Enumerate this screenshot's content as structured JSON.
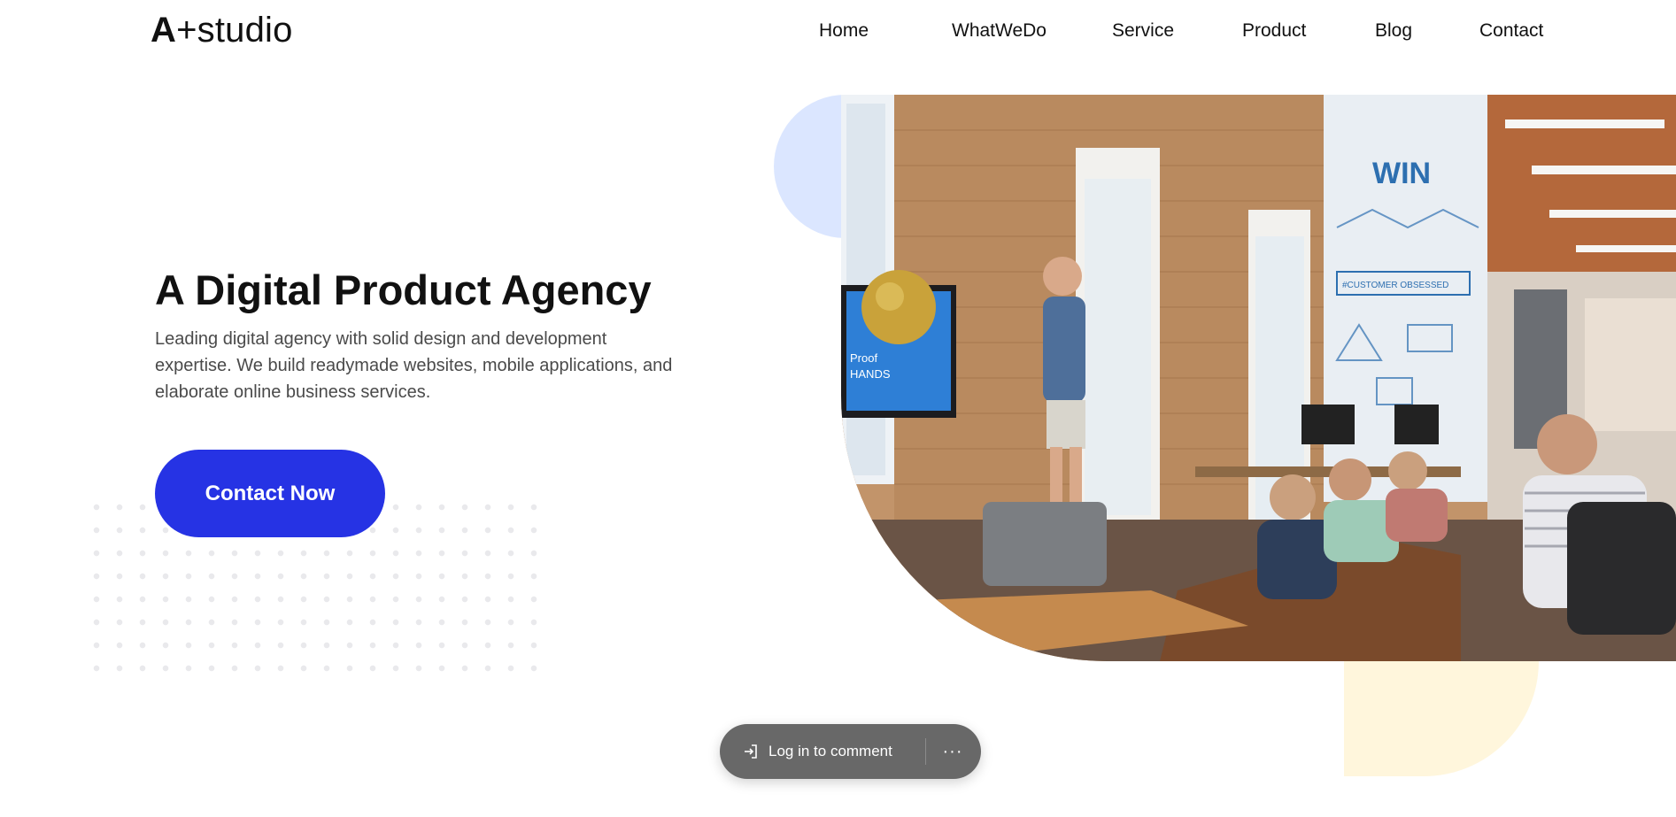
{
  "header": {
    "logo_mark": "A",
    "logo_text": "+studio",
    "nav": [
      {
        "label": "Home"
      },
      {
        "label": "WhatWeDo"
      },
      {
        "label": "Service"
      },
      {
        "label": "Product"
      },
      {
        "label": "Blog"
      },
      {
        "label": "Contact"
      }
    ]
  },
  "hero": {
    "title": "A Digital Product Agency",
    "description": "Leading digital agency with solid design and development expertise. We build readymade websites, mobile applications, and elaborate online business services.",
    "cta_label": "Contact Now",
    "image_alt": "Team meeting in a brick-walled office",
    "image_texts": {
      "wall_sign": "WIN",
      "banner": "#CUSTOMER OBSESSED",
      "screen_line1": "Proof",
      "screen_line2": "HANDS"
    }
  },
  "comment_bar": {
    "login_label": "Log in to comment",
    "more_label": "···",
    "login_icon": "login-icon",
    "more_icon": "more-icon"
  },
  "colors": {
    "accent": "#2633e4",
    "blue_blob": "#dbe6ff",
    "yellow_blob": "#fff6dc",
    "comment_bar": "#686868"
  }
}
